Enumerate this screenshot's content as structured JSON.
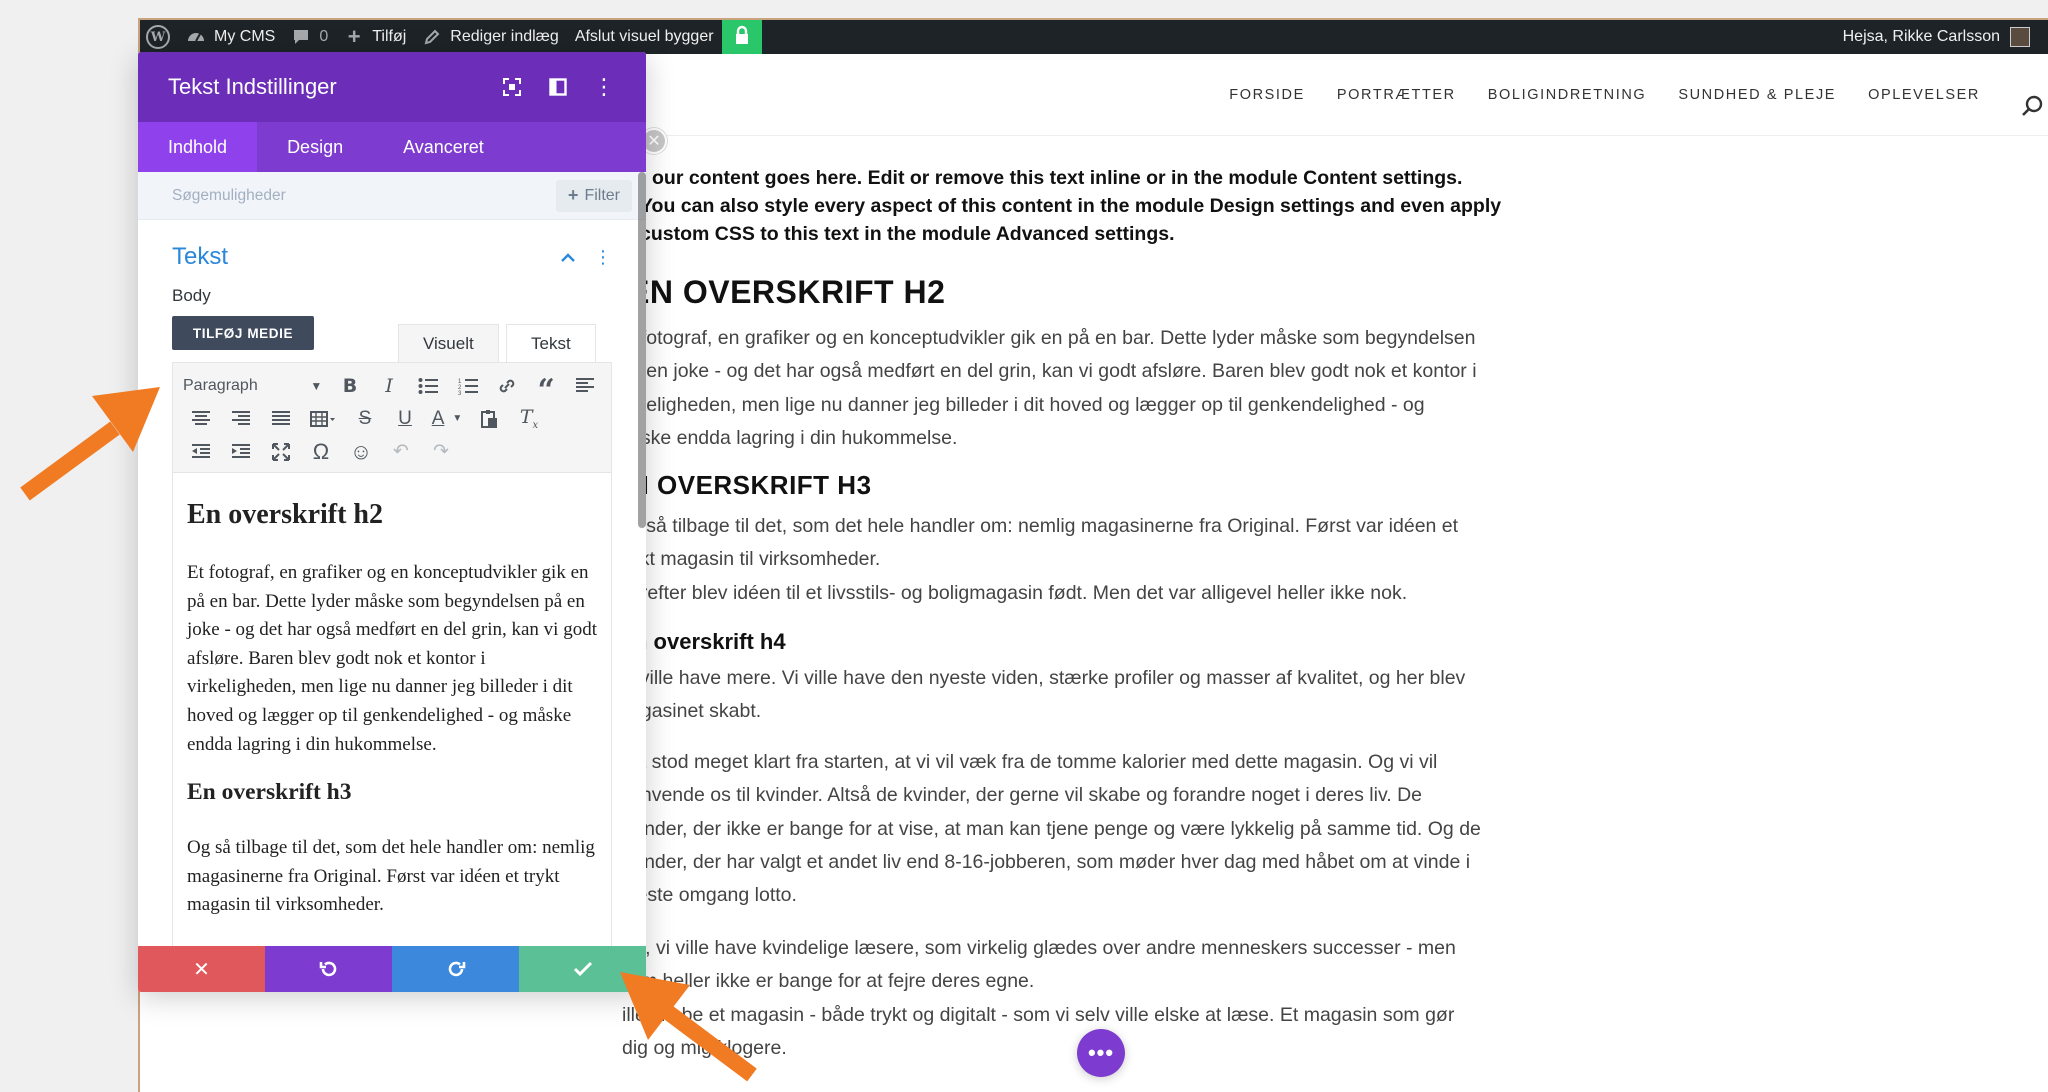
{
  "adminbar": {
    "site_name": "My CMS",
    "comments_count": "0",
    "new_label": "Tilføj",
    "edit_label": "Rediger indlæg",
    "exit_builder_label": "Afslut visuel bygger",
    "greeting": "Hejsa, Rikke Carlsson",
    "colors": {
      "bg": "#1d2327",
      "lock": "#29c66a"
    }
  },
  "nav": {
    "items": [
      "FORSIDE",
      "PORTRÆTTER",
      "BOLIGINDRETNING",
      "SUNDHED & PLEJE",
      "OPLEVELSER"
    ]
  },
  "content": {
    "intro_lines": [
      "our content goes here. Edit or remove this text inline or in the module Content settings.",
      "You can also style every aspect of this content in the module Design settings and even apply",
      "custom CSS to this text in the module Advanced settings."
    ],
    "h2": "EN OVERSKRIFT H2",
    "p1_lines": [
      "t fotograf, en grafiker og en konceptudvikler gik en på en bar. Dette lyder måske som begyndelsen",
      "å en joke - og det har også medført en del grin, kan vi godt afsløre. Baren blev godt nok et kontor i",
      "rkeligheden, men lige nu danner jeg billeder i dit hoved og lægger op til genkendelighed - og",
      "åske endda lagring i din hukommelse."
    ],
    "h3": "N OVERSKRIFT H3",
    "p2_lines": [
      "g så tilbage til det, som det hele handler om: nemlig magasinerne fra Original. Først var idéen et",
      "ykt magasin til virksomheder.",
      "erefter blev idéen til et livsstils- og boligmagasin født. Men det var alligevel heller ikke nok."
    ],
    "h4": "n overskrift h4",
    "p3_lines": [
      "i ville have mere. Vi ville have den nyeste viden, stærke profiler og masser af kvalitet, og her blev",
      "agasinet skabt."
    ],
    "p4_lines": [
      "et stod meget klart fra starten, at vi vil væk fra de tomme kalorier med dette magasin. Og vi vil",
      "envende os til kvinder. Altså de kvinder, der gerne vil skabe og forandre noget i deres liv. De",
      "vinder, der ikke er bange for at vise, at man kan tjene penge og være lykkelig på samme tid. Og de",
      "vinder, der har valgt et andet liv end 8-16-jobberen, som møder hver dag med håbet om at vinde i",
      "æste omgang lotto."
    ],
    "p5_lines": [
      "ej, vi ville have kvindelige læsere, som virkelig glædes over andre menneskers successer - men",
      "om heller ikke er bange for at fejre deres egne.",
      "ille skabe et magasin - både trykt og digitalt - som vi selv ville elske at læse. Et magasin som gør",
      "dig og mig klogere."
    ]
  },
  "panel": {
    "title": "Tekst Indstillinger",
    "tabs": [
      "Indhold",
      "Design",
      "Avanceret"
    ],
    "active_tab": "Indhold",
    "search_placeholder": "Søgemuligheder",
    "filter_label": "Filter",
    "section_title": "Tekst",
    "body_label": "Body",
    "add_media_label": "TILFØJ MEDIE",
    "editor_tabs": [
      "Visuelt",
      "Tekst"
    ],
    "format_select": "Paragraph",
    "editor": {
      "h2": "En overskrift h2",
      "p1": "Et fotograf, en grafiker og en konceptudvikler gik en på en bar. Dette lyder måske som begyndelsen på en joke - og det har også medført en del grin, kan vi godt afsløre. Baren blev godt nok et kontor i virkeligheden, men lige nu danner jeg billeder i dit hoved og lægger op til genkendelighed - og måske endda lagring i din hukommelse.",
      "h3": "En overskrift h3",
      "p2": "Og så tilbage til det, som det hele handler om: nemlig magasinerne fra Original. Først var idéen et trykt magasin til virksomheder."
    },
    "colors": {
      "header": "#6c2eb9",
      "tabs": "#7d3bcf",
      "active_tab": "#8f42ec",
      "discard": "#e0585b",
      "undo": "#7e3bd0",
      "redo": "#3c88dc",
      "save": "#5bc095",
      "section": "#2b87da"
    }
  },
  "arrows": {
    "color": "#f07b23"
  }
}
